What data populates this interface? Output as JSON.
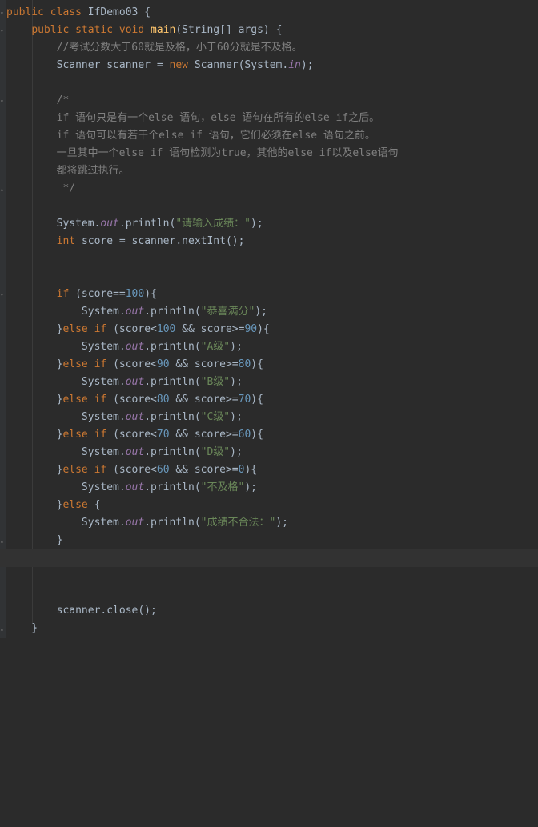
{
  "editor": {
    "language": "java",
    "theme": "darcula",
    "lines": [
      {
        "tokens": [
          {
            "t": "public class ",
            "c": "kw"
          },
          {
            "t": "IfDemo03 {"
          }
        ]
      },
      {
        "tokens": [
          {
            "t": "    "
          },
          {
            "t": "public static void ",
            "c": "kw"
          },
          {
            "t": "main",
            "c": "fn"
          },
          {
            "t": "(String[] args) {"
          }
        ]
      },
      {
        "tokens": [
          {
            "t": "        "
          },
          {
            "t": "//考试分数大于60就是及格，小于60分就是不及格。",
            "c": "cm"
          }
        ]
      },
      {
        "tokens": [
          {
            "t": "        Scanner scanner = "
          },
          {
            "t": "new ",
            "c": "kw"
          },
          {
            "t": "Scanner(System."
          },
          {
            "t": "in",
            "c": "fld"
          },
          {
            "t": ");"
          }
        ]
      },
      {
        "tokens": []
      },
      {
        "tokens": [
          {
            "t": "        "
          },
          {
            "t": "/*",
            "c": "cm"
          }
        ]
      },
      {
        "tokens": [
          {
            "t": "        "
          },
          {
            "t": "if 语句只是有一个else 语句，else 语句在所有的else if之后。",
            "c": "cm"
          }
        ]
      },
      {
        "tokens": [
          {
            "t": "        "
          },
          {
            "t": "if 语句可以有若干个else if 语句，它们必须在else 语句之前。",
            "c": "cm"
          }
        ]
      },
      {
        "tokens": [
          {
            "t": "        "
          },
          {
            "t": "一旦其中一个else if 语句检测为true，其他的else if以及else语句",
            "c": "cm"
          }
        ]
      },
      {
        "tokens": [
          {
            "t": "        "
          },
          {
            "t": "都将跳过执行。",
            "c": "cm"
          }
        ]
      },
      {
        "tokens": [
          {
            "t": "         "
          },
          {
            "t": "*/",
            "c": "cm"
          }
        ]
      },
      {
        "tokens": []
      },
      {
        "tokens": [
          {
            "t": "        System."
          },
          {
            "t": "out",
            "c": "fld"
          },
          {
            "t": ".println("
          },
          {
            "t": "\"请输入成绩：\"",
            "c": "str"
          },
          {
            "t": ");"
          }
        ]
      },
      {
        "tokens": [
          {
            "t": "        "
          },
          {
            "t": "int ",
            "c": "kw"
          },
          {
            "t": "score = scanner.nextInt();"
          }
        ]
      },
      {
        "tokens": []
      },
      {
        "tokens": []
      },
      {
        "tokens": [
          {
            "t": "        "
          },
          {
            "t": "if ",
            "c": "kw"
          },
          {
            "t": "(score=="
          },
          {
            "t": "100",
            "c": "num"
          },
          {
            "t": "){"
          }
        ]
      },
      {
        "tokens": [
          {
            "t": "            System."
          },
          {
            "t": "out",
            "c": "fld"
          },
          {
            "t": ".println("
          },
          {
            "t": "\"恭喜满分\"",
            "c": "str"
          },
          {
            "t": ");"
          }
        ]
      },
      {
        "tokens": [
          {
            "t": "        }"
          },
          {
            "t": "else if ",
            "c": "kw"
          },
          {
            "t": "(score<"
          },
          {
            "t": "100",
            "c": "num"
          },
          {
            "t": " && score>="
          },
          {
            "t": "90",
            "c": "num"
          },
          {
            "t": "){"
          }
        ]
      },
      {
        "tokens": [
          {
            "t": "            System."
          },
          {
            "t": "out",
            "c": "fld"
          },
          {
            "t": ".println("
          },
          {
            "t": "\"A级\"",
            "c": "str"
          },
          {
            "t": ");"
          }
        ]
      },
      {
        "tokens": [
          {
            "t": "        }"
          },
          {
            "t": "else if ",
            "c": "kw"
          },
          {
            "t": "(score<"
          },
          {
            "t": "90",
            "c": "num"
          },
          {
            "t": " && score>="
          },
          {
            "t": "80",
            "c": "num"
          },
          {
            "t": "){"
          }
        ]
      },
      {
        "tokens": [
          {
            "t": "            System."
          },
          {
            "t": "out",
            "c": "fld"
          },
          {
            "t": ".println("
          },
          {
            "t": "\"B级\"",
            "c": "str"
          },
          {
            "t": ");"
          }
        ]
      },
      {
        "tokens": [
          {
            "t": "        }"
          },
          {
            "t": "else if ",
            "c": "kw"
          },
          {
            "t": "(score<"
          },
          {
            "t": "80",
            "c": "num"
          },
          {
            "t": " && score>="
          },
          {
            "t": "70",
            "c": "num"
          },
          {
            "t": "){"
          }
        ]
      },
      {
        "tokens": [
          {
            "t": "            System."
          },
          {
            "t": "out",
            "c": "fld"
          },
          {
            "t": ".println("
          },
          {
            "t": "\"C级\"",
            "c": "str"
          },
          {
            "t": ");"
          }
        ]
      },
      {
        "tokens": [
          {
            "t": "        }"
          },
          {
            "t": "else if ",
            "c": "kw"
          },
          {
            "t": "(score<"
          },
          {
            "t": "70",
            "c": "num"
          },
          {
            "t": " && score>="
          },
          {
            "t": "60",
            "c": "num"
          },
          {
            "t": "){"
          }
        ]
      },
      {
        "tokens": [
          {
            "t": "            System."
          },
          {
            "t": "out",
            "c": "fld"
          },
          {
            "t": ".println("
          },
          {
            "t": "\"D级\"",
            "c": "str"
          },
          {
            "t": ");"
          }
        ]
      },
      {
        "tokens": [
          {
            "t": "        }"
          },
          {
            "t": "else if ",
            "c": "kw"
          },
          {
            "t": "(score<"
          },
          {
            "t": "60",
            "c": "num"
          },
          {
            "t": " && score>="
          },
          {
            "t": "0",
            "c": "num"
          },
          {
            "t": "){"
          }
        ]
      },
      {
        "tokens": [
          {
            "t": "            System."
          },
          {
            "t": "out",
            "c": "fld"
          },
          {
            "t": ".println("
          },
          {
            "t": "\"不及格\"",
            "c": "str"
          },
          {
            "t": ");"
          }
        ]
      },
      {
        "tokens": [
          {
            "t": "        }"
          },
          {
            "t": "else ",
            "c": "kw"
          },
          {
            "t": "{"
          }
        ]
      },
      {
        "tokens": [
          {
            "t": "            System."
          },
          {
            "t": "out",
            "c": "fld"
          },
          {
            "t": ".println("
          },
          {
            "t": "\"成绩不合法：\"",
            "c": "str"
          },
          {
            "t": ");"
          }
        ]
      },
      {
        "tokens": [
          {
            "t": "        }"
          }
        ]
      },
      {
        "tokens": []
      },
      {
        "tokens": []
      },
      {
        "tokens": []
      },
      {
        "tokens": [
          {
            "t": "        scanner.close();"
          }
        ]
      },
      {
        "tokens": [
          {
            "t": "    }"
          }
        ]
      }
    ]
  }
}
